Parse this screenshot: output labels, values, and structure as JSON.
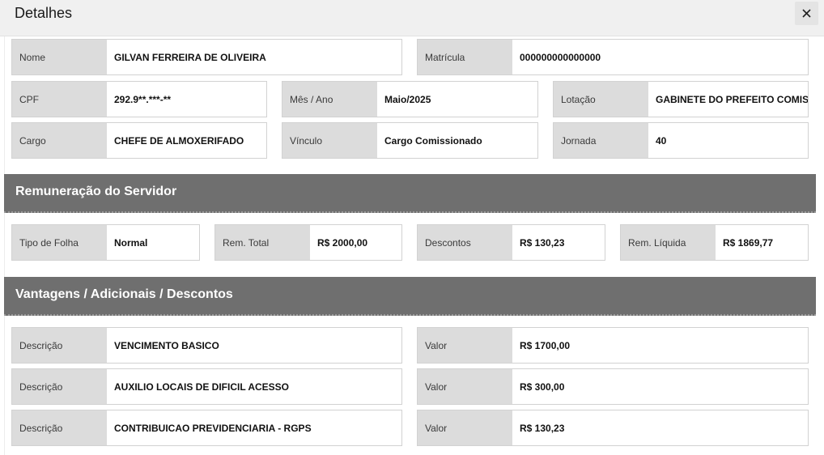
{
  "header": {
    "title": "Detalhes",
    "close_label": "×"
  },
  "servidor": {
    "nome": {
      "label": "Nome",
      "value": "GILVAN FERREIRA DE OLIVEIRA"
    },
    "matricula": {
      "label": "Matrícula",
      "value": "000000000000000"
    },
    "cpf": {
      "label": "CPF",
      "value": "292.9**.***-**"
    },
    "mes_ano": {
      "label": "Mês / Ano",
      "value": "Maio/2025"
    },
    "lotacao": {
      "label": "Lotação",
      "value": "GABINETE DO PREFEITO COMISS"
    },
    "cargo": {
      "label": "Cargo",
      "value": "CHEFE DE ALMOXERIFADO"
    },
    "vinculo": {
      "label": "Vínculo",
      "value": "Cargo Comissionado"
    },
    "jornada": {
      "label": "Jornada",
      "value": "40"
    }
  },
  "remuneracao": {
    "title": "Remuneração do Servidor",
    "tipo_folha": {
      "label": "Tipo de Folha",
      "value": "Normal"
    },
    "rem_total": {
      "label": "Rem. Total",
      "value": "R$ 2000,00"
    },
    "descontos": {
      "label": "Descontos",
      "value": "R$ 130,23"
    },
    "rem_liquida": {
      "label": "Rem. Líquida",
      "value": "R$ 1869,77"
    }
  },
  "vantagens": {
    "title": "Vantagens / Adicionais / Descontos",
    "items": [
      {
        "desc_label": "Descrição",
        "desc": "VENCIMENTO BASICO",
        "valor_label": "Valor",
        "valor": "R$ 1700,00"
      },
      {
        "desc_label": "Descrição",
        "desc": "AUXILIO LOCAIS DE DIFICIL ACESSO",
        "valor_label": "Valor",
        "valor": "R$ 300,00"
      },
      {
        "desc_label": "Descrição",
        "desc": "CONTRIBUICAO PREVIDENCIARIA - RGPS",
        "valor_label": "Valor",
        "valor": "R$ 130,23"
      }
    ]
  },
  "icons": {
    "close": "close-icon"
  }
}
